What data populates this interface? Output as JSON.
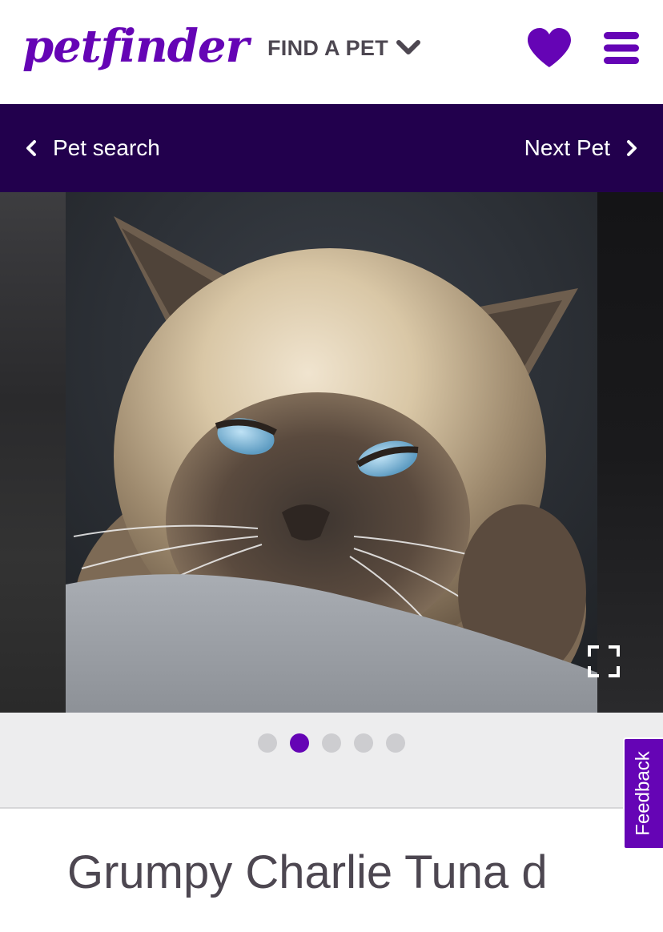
{
  "header": {
    "logo_text": "petfinder",
    "logo_reg": "®",
    "find_pet_label": "FIND A PET",
    "brand_color": "#6504b5"
  },
  "nav": {
    "back_label": "Pet search",
    "next_label": "Next Pet",
    "bar_color": "#22004d"
  },
  "carousel": {
    "dots_total": 5,
    "active_index": 1,
    "photo_subject": "siamese-cat-photo"
  },
  "feedback": {
    "label": "Feedback"
  },
  "pet": {
    "name": "Grumpy Charlie Tuna d"
  }
}
